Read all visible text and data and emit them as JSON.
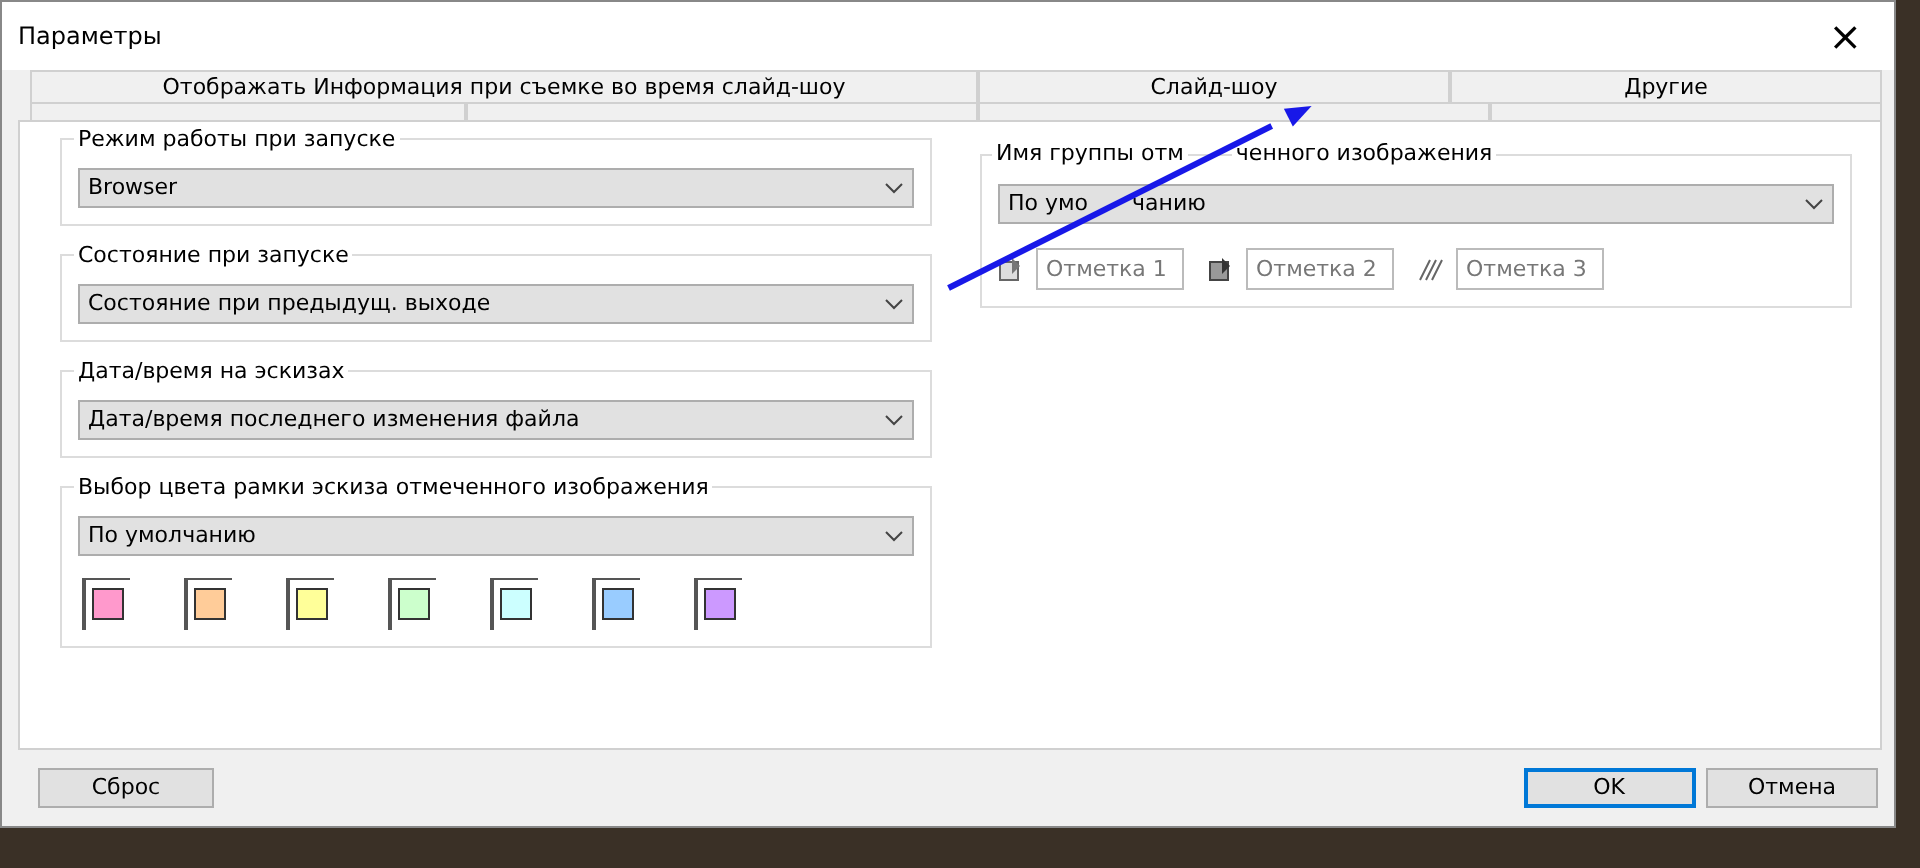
{
  "window": {
    "title": "Параметры",
    "close": "×"
  },
  "tabs": [
    {
      "label": "Отображать Информация при съемке во время слайд-шоу",
      "selected": false
    },
    {
      "label": "Слайд-шоу",
      "selected": false
    },
    {
      "label": "Другие",
      "selected": false
    }
  ],
  "left_groups": [
    {
      "legend": "Режим работы при запуске",
      "value": "Browser"
    },
    {
      "legend": "Состояние при запуске",
      "value": "Состояние при предыдущ. выходе"
    },
    {
      "legend": "Дата/время на эскизах",
      "value": "Дата/время последнего изменения файла"
    },
    {
      "legend": "Выбор цвета рамки эскиза отмеченного изображения",
      "value": "По умолчанию",
      "swatches": [
        {
          "color": "#ff99cc"
        },
        {
          "color": "#ffcc99"
        },
        {
          "color": "#ffff99"
        },
        {
          "color": "#ccffcc"
        },
        {
          "color": "#ccffff"
        },
        {
          "color": "#99ccff"
        },
        {
          "color": "#cc99ff"
        }
      ]
    }
  ],
  "right_group": {
    "legend_parts": [
      "Имя группы отм",
      "ченного изображения"
    ],
    "value_parts": [
      "По умо",
      "чанию"
    ],
    "marks": [
      {
        "placeholder": "Отметка 1"
      },
      {
        "placeholder": "Отметка 2"
      },
      {
        "placeholder": "Отметка 3"
      }
    ]
  },
  "buttons": [
    {
      "label": "Сброс",
      "focused": false
    },
    {
      "label": "OK",
      "focused": true
    },
    {
      "label": "Отмена",
      "focused": false
    }
  ]
}
